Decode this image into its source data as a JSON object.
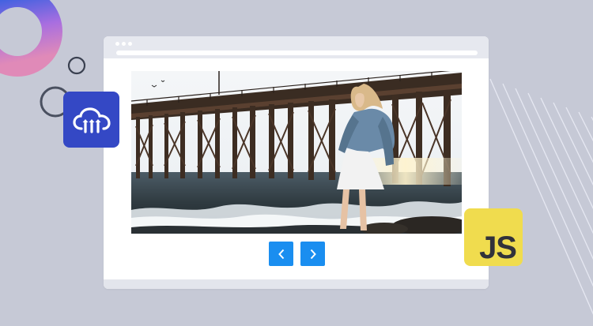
{
  "page": {
    "background_color": "#c6c9d6"
  },
  "decorations": {
    "gradient_ring_colors": [
      "#2d5fe0",
      "#a86ee0",
      "#e08ab8"
    ],
    "outline_circle_color": "#3a4050",
    "diagonal_lines_color": "#e6e8f2"
  },
  "browser_window": {
    "window_dots": 3,
    "frame_color": "#e6e8ef"
  },
  "carousel": {
    "image_description_icon": "photo-woman-on-beach-by-pier",
    "prev_icon": "chevron-left-icon",
    "next_icon": "chevron-right-icon",
    "button_color": "#1a8ef0"
  },
  "logos": {
    "cloudinary": {
      "icon": "cloudinary-cloud-icon",
      "tile_color": "#3448c5"
    },
    "javascript": {
      "label": "JS",
      "tile_color": "#f0dc4e",
      "text_color": "#32323a"
    }
  }
}
